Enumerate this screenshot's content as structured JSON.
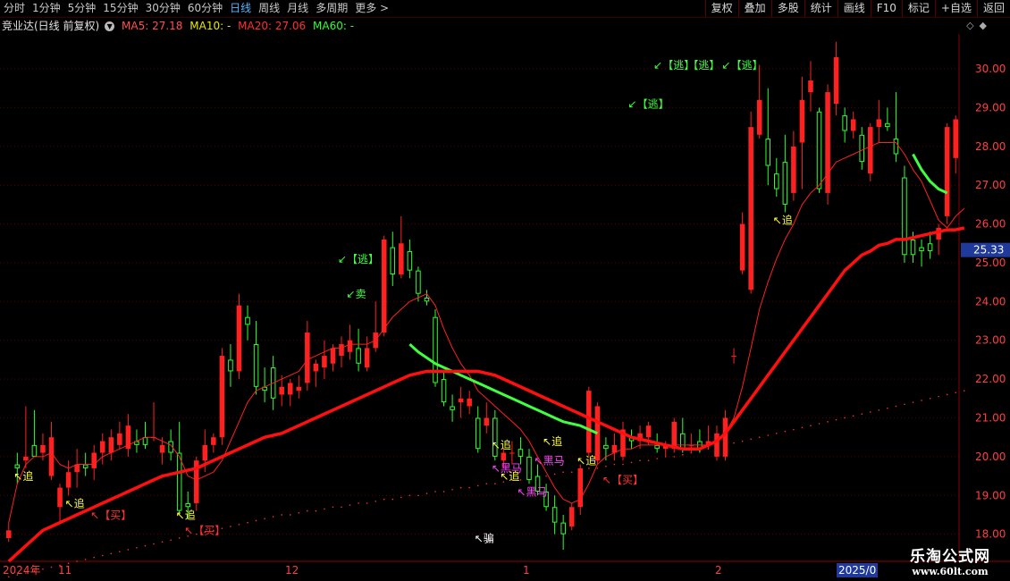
{
  "toolbar": {
    "tabs": [
      "分时",
      "1分钟",
      "5分钟",
      "15分钟",
      "30分钟",
      "60分钟",
      "日线",
      "周线",
      "月线",
      "多周期",
      "更多 >"
    ],
    "active_tab": 6,
    "right_buttons": [
      "复权",
      "叠加",
      "多股",
      "统计",
      "画线",
      "F10",
      "标记",
      "+自选",
      "返回"
    ]
  },
  "info": {
    "stock": "竞业达(日线 前复权)",
    "ma5": "MA5: 27.18",
    "ma10": "MA10: -",
    "ma20": "MA20: 27.06",
    "ma60": "MA60: -"
  },
  "colors": {
    "up": "#ff2020",
    "down": "#30ff30",
    "ma": "#ff2020",
    "grid": "#5a0000",
    "price_tag": "#1f3a9a"
  },
  "axis": {
    "price_labels": [
      "30.00",
      "29.00",
      "28.00",
      "27.00",
      "26.00",
      "25.00",
      "24.00",
      "23.00",
      "22.00",
      "21.00",
      "20.00",
      "19.00",
      "18.00"
    ],
    "current_price": "25.33",
    "date_labels": [
      "2024年",
      "11",
      "12",
      "1",
      "2",
      "2025/0"
    ]
  },
  "signals": [
    {
      "text": "↖追",
      "color": "#ffff40"
    },
    {
      "text": "↖追",
      "color": "#ffff40"
    },
    {
      "text": "↖【买】",
      "color": "#ff3030"
    },
    {
      "text": "↖追",
      "color": "#ffff40"
    },
    {
      "text": "↖【买】",
      "color": "#ff3030"
    },
    {
      "text": "↙【逃】",
      "color": "#40ff40"
    },
    {
      "text": "↙卖",
      "color": "#40ff40"
    },
    {
      "text": "↖骗",
      "color": "#ffffff"
    },
    {
      "text": "↖追",
      "color": "#ffff40"
    },
    {
      "text": "↖黑马",
      "color": "#ff40ff"
    },
    {
      "text": "↖追",
      "color": "#ffff40"
    },
    {
      "text": "↖黑马",
      "color": "#ff40ff"
    },
    {
      "text": "↖追",
      "color": "#ffff40"
    },
    {
      "text": "↖黑马",
      "color": "#ff40ff"
    },
    {
      "text": "↖追",
      "color": "#ffff40"
    },
    {
      "text": "↖【买】",
      "color": "#ff3030"
    },
    {
      "text": "↙【逃】",
      "color": "#40ff40"
    },
    {
      "text": "↙【逃】",
      "color": "#40ff40"
    },
    {
      "text": "【逃】",
      "color": "#40ff40"
    },
    {
      "text": "↙【逃】",
      "color": "#40ff40"
    },
    {
      "text": "↖追",
      "color": "#ffff40"
    }
  ],
  "chart_data": {
    "type": "candlestick",
    "y_range": [
      17.3,
      30.9
    ],
    "candles": [
      {
        "o": 17.9,
        "h": 18.3,
        "l": 17.8,
        "c": 18.1
      },
      {
        "o": 19.8,
        "h": 20.1,
        "l": 19.3,
        "c": 19.7
      },
      {
        "o": 19.9,
        "h": 21.3,
        "l": 19.7,
        "c": 20.0
      },
      {
        "o": 20.3,
        "h": 21.2,
        "l": 20.0,
        "c": 20.0
      },
      {
        "o": 20.1,
        "h": 20.6,
        "l": 19.9,
        "c": 20.3
      },
      {
        "o": 19.5,
        "h": 20.9,
        "l": 19.4,
        "c": 20.5
      },
      {
        "o": 18.7,
        "h": 19.3,
        "l": 18.3,
        "c": 19.2
      },
      {
        "o": 19.2,
        "h": 19.9,
        "l": 19.0,
        "c": 19.6
      },
      {
        "o": 19.6,
        "h": 20.2,
        "l": 19.2,
        "c": 19.8
      },
      {
        "o": 19.8,
        "h": 20.1,
        "l": 19.5,
        "c": 19.7
      },
      {
        "o": 19.7,
        "h": 20.3,
        "l": 19.4,
        "c": 20.1
      },
      {
        "o": 20.1,
        "h": 20.6,
        "l": 19.8,
        "c": 20.4
      },
      {
        "o": 20.1,
        "h": 20.7,
        "l": 19.9,
        "c": 20.5
      },
      {
        "o": 20.3,
        "h": 20.9,
        "l": 20.2,
        "c": 20.6
      },
      {
        "o": 20.2,
        "h": 21.1,
        "l": 20.0,
        "c": 20.8
      },
      {
        "o": 20.4,
        "h": 20.7,
        "l": 20.1,
        "c": 20.3
      },
      {
        "o": 20.5,
        "h": 20.9,
        "l": 20.2,
        "c": 20.3
      },
      {
        "o": 20.5,
        "h": 21.4,
        "l": 20.4,
        "c": 20.5
      },
      {
        "o": 20.1,
        "h": 20.5,
        "l": 19.8,
        "c": 20.3
      },
      {
        "o": 20.4,
        "h": 20.7,
        "l": 19.9,
        "c": 20.1
      },
      {
        "o": 20.1,
        "h": 20.9,
        "l": 18.5,
        "c": 18.6
      },
      {
        "o": 18.8,
        "h": 19.1,
        "l": 18.4,
        "c": 18.7
      },
      {
        "o": 18.8,
        "h": 20.0,
        "l": 18.6,
        "c": 19.9
      },
      {
        "o": 19.9,
        "h": 20.7,
        "l": 19.6,
        "c": 20.3
      },
      {
        "o": 20.3,
        "h": 20.6,
        "l": 20.1,
        "c": 20.5
      },
      {
        "o": 20.5,
        "h": 22.8,
        "l": 20.3,
        "c": 22.6
      },
      {
        "o": 22.5,
        "h": 22.9,
        "l": 21.8,
        "c": 22.2
      },
      {
        "o": 22.2,
        "h": 24.2,
        "l": 22.0,
        "c": 23.9
      },
      {
        "o": 23.6,
        "h": 23.9,
        "l": 23.0,
        "c": 23.4
      },
      {
        "o": 22.9,
        "h": 23.5,
        "l": 21.6,
        "c": 21.8
      },
      {
        "o": 21.8,
        "h": 22.3,
        "l": 21.4,
        "c": 21.7
      },
      {
        "o": 22.3,
        "h": 22.6,
        "l": 21.2,
        "c": 21.5
      },
      {
        "o": 21.6,
        "h": 22.1,
        "l": 21.3,
        "c": 21.8
      },
      {
        "o": 21.6,
        "h": 22.0,
        "l": 21.3,
        "c": 21.9
      },
      {
        "o": 21.7,
        "h": 22.1,
        "l": 21.5,
        "c": 21.8
      },
      {
        "o": 21.9,
        "h": 23.5,
        "l": 21.7,
        "c": 23.2
      },
      {
        "o": 22.2,
        "h": 22.5,
        "l": 21.8,
        "c": 22.4
      },
      {
        "o": 22.3,
        "h": 23.0,
        "l": 22.0,
        "c": 22.6
      },
      {
        "o": 22.4,
        "h": 22.9,
        "l": 22.2,
        "c": 22.8
      },
      {
        "o": 22.6,
        "h": 23.1,
        "l": 22.3,
        "c": 22.9
      },
      {
        "o": 22.7,
        "h": 23.4,
        "l": 22.5,
        "c": 23.0
      },
      {
        "o": 22.8,
        "h": 23.3,
        "l": 22.2,
        "c": 22.4
      },
      {
        "o": 22.3,
        "h": 23.1,
        "l": 22.2,
        "c": 22.8
      },
      {
        "o": 22.8,
        "h": 24.0,
        "l": 22.7,
        "c": 23.2
      },
      {
        "o": 23.2,
        "h": 25.7,
        "l": 23.1,
        "c": 25.6
      },
      {
        "o": 25.4,
        "h": 25.8,
        "l": 24.4,
        "c": 24.7
      },
      {
        "o": 24.7,
        "h": 26.2,
        "l": 24.6,
        "c": 25.5
      },
      {
        "o": 25.3,
        "h": 25.6,
        "l": 24.6,
        "c": 24.8
      },
      {
        "o": 24.8,
        "h": 24.9,
        "l": 24.0,
        "c": 24.2
      },
      {
        "o": 24.1,
        "h": 24.3,
        "l": 23.9,
        "c": 24.0
      },
      {
        "o": 23.6,
        "h": 23.8,
        "l": 21.8,
        "c": 21.9
      },
      {
        "o": 22.0,
        "h": 22.2,
        "l": 21.3,
        "c": 21.4
      },
      {
        "o": 21.3,
        "h": 21.6,
        "l": 20.9,
        "c": 21.2
      },
      {
        "o": 21.4,
        "h": 21.8,
        "l": 21.0,
        "c": 21.5
      },
      {
        "o": 21.3,
        "h": 21.7,
        "l": 21.1,
        "c": 21.5
      },
      {
        "o": 21.0,
        "h": 21.3,
        "l": 20.1,
        "c": 20.2
      },
      {
        "o": 20.8,
        "h": 21.4,
        "l": 20.6,
        "c": 21.0
      },
      {
        "o": 21.0,
        "h": 21.2,
        "l": 19.9,
        "c": 20.0
      },
      {
        "o": 19.9,
        "h": 20.2,
        "l": 19.7,
        "c": 20.1
      },
      {
        "o": 20.1,
        "h": 20.4,
        "l": 19.8,
        "c": 20.1
      },
      {
        "o": 20.2,
        "h": 20.5,
        "l": 19.8,
        "c": 20.0
      },
      {
        "o": 20.0,
        "h": 20.2,
        "l": 19.3,
        "c": 19.4
      },
      {
        "o": 19.5,
        "h": 19.8,
        "l": 19.0,
        "c": 19.1
      },
      {
        "o": 19.1,
        "h": 19.3,
        "l": 18.6,
        "c": 18.7
      },
      {
        "o": 18.7,
        "h": 19.0,
        "l": 18.0,
        "c": 18.3
      },
      {
        "o": 18.3,
        "h": 18.5,
        "l": 17.6,
        "c": 18.0
      },
      {
        "o": 18.2,
        "h": 18.8,
        "l": 18.1,
        "c": 18.7
      },
      {
        "o": 18.7,
        "h": 19.8,
        "l": 18.5,
        "c": 19.7
      },
      {
        "o": 20.1,
        "h": 21.8,
        "l": 20.0,
        "c": 21.7
      },
      {
        "o": 19.9,
        "h": 21.4,
        "l": 19.8,
        "c": 21.3
      },
      {
        "o": 20.3,
        "h": 20.5,
        "l": 19.9,
        "c": 20.2
      },
      {
        "o": 20.1,
        "h": 20.6,
        "l": 19.9,
        "c": 20.3
      },
      {
        "o": 20.0,
        "h": 20.9,
        "l": 19.9,
        "c": 20.7
      },
      {
        "o": 20.5,
        "h": 20.7,
        "l": 20.2,
        "c": 20.4
      },
      {
        "o": 20.4,
        "h": 20.8,
        "l": 20.2,
        "c": 20.6
      },
      {
        "o": 20.5,
        "h": 20.9,
        "l": 20.3,
        "c": 20.8
      },
      {
        "o": 20.3,
        "h": 20.6,
        "l": 20.1,
        "c": 20.2
      },
      {
        "o": 20.2,
        "h": 20.4,
        "l": 20.0,
        "c": 20.3
      },
      {
        "o": 20.2,
        "h": 21.0,
        "l": 20.1,
        "c": 20.9
      },
      {
        "o": 20.6,
        "h": 21.0,
        "l": 20.1,
        "c": 20.2
      },
      {
        "o": 20.3,
        "h": 20.6,
        "l": 20.1,
        "c": 20.3
      },
      {
        "o": 20.4,
        "h": 20.7,
        "l": 20.1,
        "c": 20.2
      },
      {
        "o": 20.3,
        "h": 20.8,
        "l": 20.2,
        "c": 20.4
      },
      {
        "o": 20.0,
        "h": 20.8,
        "l": 19.9,
        "c": 20.6
      },
      {
        "o": 20.0,
        "h": 21.2,
        "l": 19.9,
        "c": 21.0
      },
      {
        "o": 22.6,
        "h": 22.8,
        "l": 22.4,
        "c": 22.6
      },
      {
        "o": 24.8,
        "h": 26.3,
        "l": 24.7,
        "c": 26.0
      },
      {
        "o": 24.3,
        "h": 28.9,
        "l": 24.2,
        "c": 28.5
      },
      {
        "o": 28.3,
        "h": 30.1,
        "l": 28.2,
        "c": 29.2
      },
      {
        "o": 28.2,
        "h": 29.5,
        "l": 27.0,
        "c": 27.5
      },
      {
        "o": 27.3,
        "h": 27.7,
        "l": 26.7,
        "c": 26.9
      },
      {
        "o": 27.6,
        "h": 28.3,
        "l": 26.3,
        "c": 26.5
      },
      {
        "o": 26.8,
        "h": 28.4,
        "l": 26.6,
        "c": 28.0
      },
      {
        "o": 28.1,
        "h": 29.8,
        "l": 26.9,
        "c": 29.2
      },
      {
        "o": 29.4,
        "h": 30.2,
        "l": 28.9,
        "c": 29.7
      },
      {
        "o": 28.9,
        "h": 29.0,
        "l": 26.8,
        "c": 26.9
      },
      {
        "o": 26.8,
        "h": 29.6,
        "l": 26.5,
        "c": 29.4
      },
      {
        "o": 29.1,
        "h": 30.7,
        "l": 28.8,
        "c": 30.3
      },
      {
        "o": 28.8,
        "h": 29.0,
        "l": 28.1,
        "c": 28.4
      },
      {
        "o": 28.4,
        "h": 28.9,
        "l": 28.2,
        "c": 28.7
      },
      {
        "o": 28.3,
        "h": 28.5,
        "l": 27.4,
        "c": 27.6
      },
      {
        "o": 27.3,
        "h": 28.6,
        "l": 27.1,
        "c": 28.5
      },
      {
        "o": 28.5,
        "h": 29.2,
        "l": 28.1,
        "c": 28.7
      },
      {
        "o": 28.6,
        "h": 29.0,
        "l": 28.4,
        "c": 28.5
      },
      {
        "o": 28.2,
        "h": 29.4,
        "l": 27.6,
        "c": 27.8
      },
      {
        "o": 27.2,
        "h": 27.5,
        "l": 25.0,
        "c": 25.2
      },
      {
        "o": 25.6,
        "h": 25.8,
        "l": 25.0,
        "c": 25.2
      },
      {
        "o": 25.4,
        "h": 25.6,
        "l": 24.9,
        "c": 25.3
      },
      {
        "o": 25.5,
        "h": 25.8,
        "l": 25.1,
        "c": 25.3
      },
      {
        "o": 25.6,
        "h": 26.0,
        "l": 25.2,
        "c": 25.9
      },
      {
        "o": 26.2,
        "h": 28.6,
        "l": 26.0,
        "c": 28.5
      },
      {
        "o": 27.7,
        "h": 28.8,
        "l": 27.3,
        "c": 28.7
      }
    ],
    "ma_short": [
      18.3,
      19.3,
      19.8,
      20.0,
      20.0,
      20.1,
      19.8,
      19.7,
      19.8,
      19.8,
      19.8,
      20.0,
      20.1,
      20.2,
      20.3,
      20.4,
      20.5,
      20.5,
      20.4,
      20.3,
      20.0,
      19.5,
      19.4,
      19.5,
      19.6,
      19.9,
      20.4,
      20.9,
      21.4,
      21.7,
      21.8,
      21.9,
      22.0,
      22.1,
      22.2,
      22.5,
      22.6,
      22.7,
      22.8,
      22.8,
      22.9,
      22.9,
      22.9,
      23.0,
      23.3,
      23.6,
      23.8,
      24.0,
      24.1,
      24.2,
      23.9,
      23.3,
      22.8,
      22.4,
      22.1,
      21.7,
      21.5,
      21.3,
      21.1,
      20.9,
      20.7,
      20.4,
      20.0,
      19.6,
      19.2,
      18.9,
      18.8,
      18.9,
      19.3,
      19.8,
      20.0,
      20.1,
      20.2,
      20.2,
      20.3,
      20.3,
      20.3,
      20.3,
      20.3,
      20.3,
      20.3,
      20.3,
      20.3,
      20.4,
      20.6,
      21.0,
      21.8,
      22.8,
      23.8,
      24.5,
      25.1,
      25.6,
      26.0,
      26.5,
      26.8,
      27.0,
      27.3,
      27.6,
      27.7,
      27.8,
      27.9,
      28.0,
      28.1,
      28.1,
      28.1,
      27.8,
      27.4,
      27.1,
      26.6,
      26.1,
      25.9,
      26.2,
      26.4
    ],
    "ma_long": [
      17.3,
      17.5,
      17.7,
      17.9,
      18.1,
      18.2,
      18.3,
      18.4,
      18.5,
      18.6,
      18.7,
      18.8,
      18.9,
      19.0,
      19.1,
      19.2,
      19.3,
      19.4,
      19.5,
      19.55,
      19.6,
      19.65,
      19.7,
      19.8,
      19.9,
      20.0,
      20.1,
      20.2,
      20.3,
      20.4,
      20.5,
      20.55,
      20.6,
      20.7,
      20.8,
      20.9,
      21.0,
      21.1,
      21.2,
      21.3,
      21.4,
      21.5,
      21.6,
      21.7,
      21.8,
      21.9,
      22.0,
      22.1,
      22.15,
      22.2,
      22.2,
      22.2,
      22.2,
      22.2,
      22.2,
      22.2,
      22.15,
      22.1,
      22.0,
      21.9,
      21.8,
      21.7,
      21.6,
      21.5,
      21.4,
      21.3,
      21.2,
      21.1,
      21.0,
      20.9,
      20.8,
      20.7,
      20.6,
      20.5,
      20.45,
      20.4,
      20.35,
      20.3,
      20.25,
      20.2,
      20.2,
      20.2,
      20.3,
      20.4,
      20.6,
      20.9,
      21.2,
      21.5,
      21.8,
      22.1,
      22.4,
      22.7,
      23.0,
      23.3,
      23.6,
      23.9,
      24.2,
      24.5,
      24.8,
      25.0,
      25.2,
      25.3,
      25.45,
      25.5,
      25.6,
      25.6,
      25.65,
      25.7,
      25.75,
      25.8,
      25.85,
      25.85,
      25.9
    ],
    "ma_mid": [
      null,
      null,
      null,
      null,
      null,
      null,
      null,
      null,
      null,
      null,
      null,
      null,
      null,
      null,
      null,
      null,
      null,
      null,
      null,
      null,
      null,
      null,
      null,
      null,
      null,
      null,
      null,
      null,
      null,
      null,
      null,
      null,
      null,
      null,
      null,
      null,
      null,
      null,
      null,
      null,
      null,
      null,
      null,
      null,
      null,
      null,
      null,
      22.9,
      22.7,
      22.55,
      22.4,
      22.3,
      22.2,
      22.1,
      22.0,
      21.9,
      21.8,
      21.7,
      21.6,
      21.5,
      21.4,
      21.3,
      21.2,
      21.1,
      21.0,
      20.9,
      20.85,
      20.8,
      20.7,
      20.6,
      null,
      null,
      null,
      null,
      null,
      null,
      null,
      null,
      null,
      null,
      null,
      null,
      null,
      null,
      null,
      null,
      null,
      null,
      null,
      null,
      null,
      null,
      null,
      null,
      null,
      null,
      null,
      null,
      null,
      null,
      null,
      null,
      null,
      null,
      null,
      null,
      27.8,
      27.4,
      27.1,
      26.9,
      26.8,
      null,
      null
    ],
    "ma_dots": [
      16.9,
      16.95,
      17.0,
      17.05,
      17.1,
      17.15,
      17.2,
      17.25,
      17.3,
      17.35,
      17.4,
      17.45,
      17.5,
      17.55,
      17.6,
      17.65,
      17.7,
      17.75,
      17.8,
      17.85,
      17.9,
      17.95,
      18.0,
      18.05,
      18.1,
      18.15,
      18.2,
      18.25,
      18.3,
      18.35,
      18.4,
      18.45,
      18.5,
      18.5,
      18.55,
      18.6,
      18.6,
      18.65,
      18.7,
      18.7,
      18.75,
      18.8,
      18.8,
      18.85,
      18.9,
      18.9,
      18.95,
      19.0,
      19.0,
      19.05,
      19.1,
      19.1,
      19.15,
      19.2,
      19.2,
      19.25,
      19.3,
      19.3,
      19.35,
      19.4,
      19.4,
      19.45,
      19.5,
      19.5,
      19.55,
      19.6,
      19.6,
      19.65,
      19.7,
      19.7,
      19.75,
      19.8,
      19.8,
      19.85,
      19.9,
      19.9,
      19.95,
      20.0,
      20.0,
      20.05,
      20.1,
      20.15,
      20.2,
      20.25,
      20.3,
      20.35,
      20.4,
      20.45,
      20.5,
      20.55,
      20.6,
      20.65,
      20.7,
      20.75,
      20.8,
      20.85,
      20.9,
      20.95,
      21.0,
      21.05,
      21.1,
      21.15,
      21.2,
      21.25,
      21.3,
      21.35,
      21.4,
      21.45,
      21.5,
      21.55,
      21.6,
      21.65,
      21.7
    ]
  }
}
